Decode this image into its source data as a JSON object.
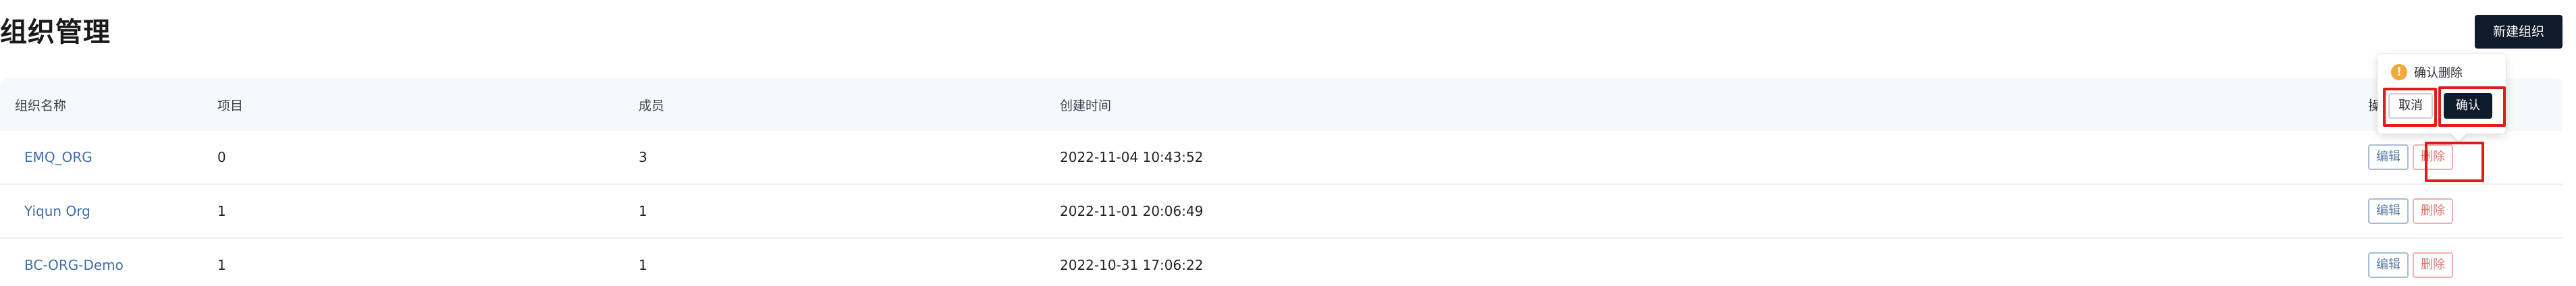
{
  "page": {
    "title": "组织管理",
    "new_button_label": "新建组织"
  },
  "table": {
    "headers": {
      "name": "组织名称",
      "projects": "项目",
      "members": "成员",
      "created_at": "创建时间",
      "ops": "操"
    },
    "rows": [
      {
        "name": "EMQ_ORG",
        "projects": "0",
        "members": "3",
        "created_at": "2022-11-04 10:43:52",
        "edit_label": "编辑",
        "delete_label": "删除"
      },
      {
        "name": "Yiqun Org",
        "projects": "1",
        "members": "1",
        "created_at": "2022-11-01 20:06:49",
        "edit_label": "编辑",
        "delete_label": "删除"
      },
      {
        "name": "BC-ORG-Demo",
        "projects": "1",
        "members": "1",
        "created_at": "2022-10-31 17:06:22",
        "edit_label": "编辑",
        "delete_label": "删除"
      }
    ]
  },
  "popconfirm": {
    "icon": "warning-icon",
    "icon_glyph": "!",
    "message": "确认删除",
    "cancel_label": "取消",
    "confirm_label": "确认"
  },
  "colors": {
    "primary_dark": "#0f1b2a",
    "link": "#3f6ea6",
    "danger": "#d9776f",
    "warning": "#f0a93b",
    "annotation_red": "#e01b1b"
  }
}
